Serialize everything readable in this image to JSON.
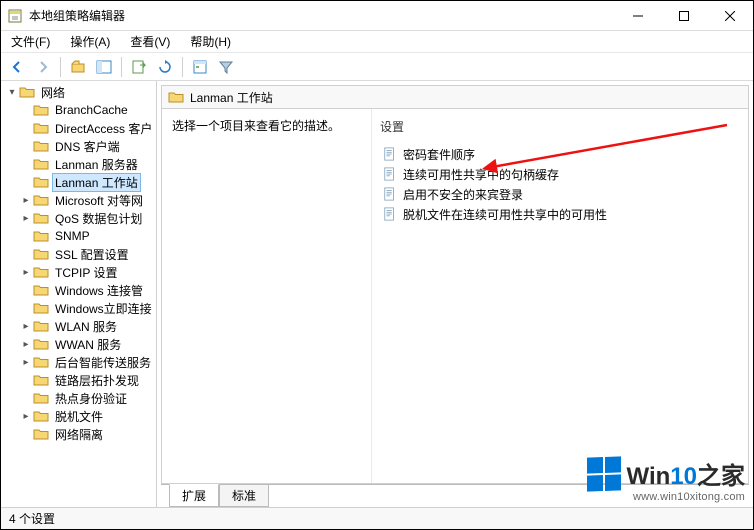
{
  "window": {
    "title": "本地组策略编辑器"
  },
  "menu": {
    "file": "文件(F)",
    "action": "操作(A)",
    "view": "查看(V)",
    "help": "帮助(H)"
  },
  "tree": {
    "root": "网络",
    "items": [
      "BranchCache",
      "DirectAccess 客户",
      "DNS 客户端",
      "Lanman 服务器",
      "Lanman 工作站",
      "Microsoft 对等网",
      "QoS 数据包计划",
      "SNMP",
      "SSL 配置设置",
      "TCPIP 设置",
      "Windows 连接管",
      "Windows立即连接",
      "WLAN 服务",
      "WWAN 服务",
      "后台智能传送服务",
      "链路层拓扑发现",
      "热点身份验证",
      "脱机文件",
      "网络隔离"
    ],
    "selected_index": 4
  },
  "content": {
    "path_title": "Lanman 工作站",
    "desc": "选择一个项目来查看它的描述。",
    "col_header": "设置",
    "settings": [
      "密码套件顺序",
      "连续可用性共享中的句柄缓存",
      "启用不安全的来宾登录",
      "脱机文件在连续可用性共享中的可用性"
    ]
  },
  "tabs": {
    "extended": "扩展",
    "standard": "标准"
  },
  "status": {
    "text": "4 个设置"
  },
  "watermark": {
    "brand_a": "Win",
    "brand_b": "10",
    "brand_c": "之家",
    "url": "www.win10xitong.com"
  }
}
